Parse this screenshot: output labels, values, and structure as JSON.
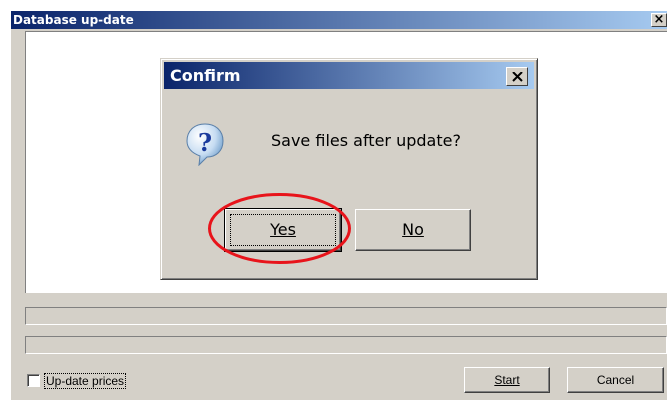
{
  "main_window": {
    "title": "Database up-date",
    "close_glyph": "×"
  },
  "options": {
    "update_prices_label": "Up-date prices",
    "update_prices_checked": false
  },
  "buttons": {
    "start": "Start",
    "cancel": "Cancel"
  },
  "confirm_dialog": {
    "title": "Confirm",
    "message": "Save files after update?",
    "icon": "question-icon",
    "yes_label": "Yes",
    "no_label": "No",
    "default_button": "Yes"
  },
  "annotation": {
    "highlight_color": "#e8141b",
    "highlighted": "Yes"
  },
  "colors": {
    "titlebar_start": "#0a246a",
    "titlebar_end": "#a6caf0",
    "face": "#d4d0c8"
  }
}
